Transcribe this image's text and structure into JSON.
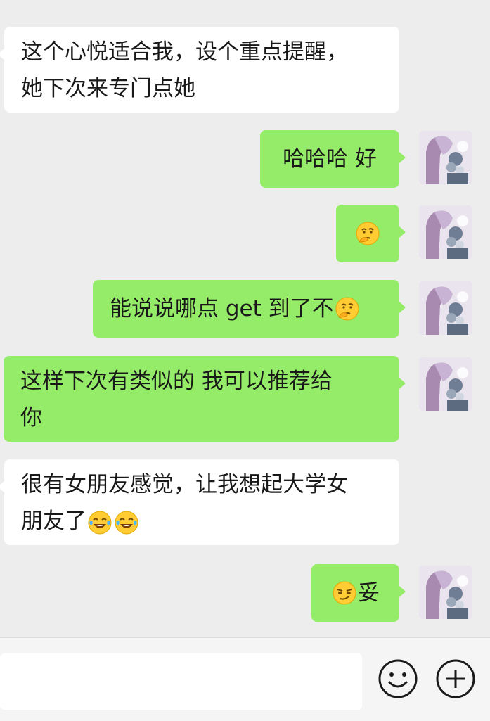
{
  "messages": [
    {
      "side": "left",
      "lines": [
        "这个心悦适合我，设个重点提醒，",
        "她下次来专门点她"
      ]
    },
    {
      "side": "right",
      "text": "哈哈哈 好"
    },
    {
      "side": "right",
      "emoji": "thinking-face"
    },
    {
      "side": "right",
      "text": "能说说哪点 get 到了不",
      "trailing_emoji": "thinking-face"
    },
    {
      "side": "right",
      "lines": [
        "这样下次有类似的 我可以推荐给",
        "你"
      ]
    },
    {
      "side": "left",
      "lines": [
        "很有女朋友感觉，让我想起大学女",
        "朋友了"
      ],
      "trailing_emoji": [
        "tears-of-joy",
        "tears-of-joy"
      ]
    },
    {
      "side": "right",
      "text": "妥",
      "leading_emoji": "smirk-face"
    }
  ],
  "input_bar": {
    "emoji_icon": "smiley-icon",
    "plus_icon": "plus-circle-icon"
  },
  "colors": {
    "background": "#ededed",
    "sent_bubble": "#95ec69",
    "received_bubble": "#ffffff"
  }
}
